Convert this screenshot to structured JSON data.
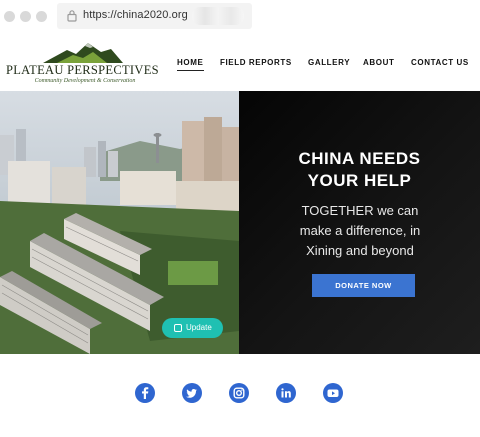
{
  "browser": {
    "url": "https://china2020.org"
  },
  "site": {
    "logo": {
      "title": "PLATEAU PERSPECTIVES",
      "tagline": "Community Development & Conservation"
    },
    "nav": {
      "items": [
        {
          "label": "HOME",
          "active": true
        },
        {
          "label": "FIELD REPORTS"
        },
        {
          "label": "GALLERY"
        },
        {
          "label": "ABOUT"
        },
        {
          "label": "CONTACT US"
        }
      ]
    }
  },
  "hero": {
    "heading_line1": "CHINA NEEDS",
    "heading_line2": "YOUR HELP",
    "sub_line1": "TOGETHER we can",
    "sub_line2": "make a difference, in",
    "sub_line3": "Xining and beyond",
    "donate_label": "DONATE NOW",
    "update_label": "Update"
  },
  "footer": {
    "social": [
      "facebook-icon",
      "twitter-icon",
      "instagram-icon",
      "linkedin-icon",
      "youtube-icon"
    ]
  },
  "colors": {
    "accent": "#3b74d1",
    "social": "#2f66d0",
    "teal": "#1fc0b2",
    "panel": "#0b0b0b"
  }
}
